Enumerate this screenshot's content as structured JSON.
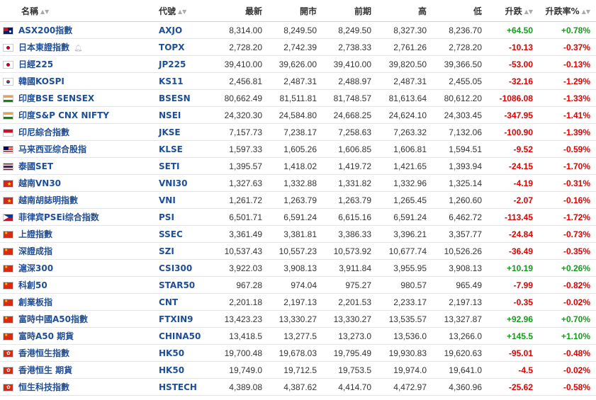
{
  "headers": {
    "name": "名稱",
    "code": "代號",
    "last": "最新",
    "open": "開市",
    "prev": "前期",
    "high": "高",
    "low": "低",
    "change": "升跌",
    "change_pct": "升跌率%"
  },
  "colors": {
    "positive": "#149b1c",
    "negative": "#e00000",
    "link": "#1f4e96"
  },
  "rows": [
    {
      "flag": "au",
      "name": "ASX200指數",
      "code": "AXJO",
      "last": "8,314.00",
      "open": "8,249.50",
      "prev": "8,249.50",
      "high": "8,327.30",
      "low": "8,236.70",
      "change": "+64.50",
      "pct": "+0.78%",
      "dir": "pos"
    },
    {
      "flag": "jp",
      "name": "日本東證指數",
      "code": "TOPX",
      "last": "2,728.20",
      "open": "2,742.39",
      "prev": "2,738.33",
      "high": "2,761.26",
      "low": "2,728.20",
      "change": "-10.13",
      "pct": "-0.37%",
      "dir": "neg",
      "bell": true
    },
    {
      "flag": "jp",
      "name": "日經225",
      "code": "JP225",
      "last": "39,410.00",
      "open": "39,626.00",
      "prev": "39,410.00",
      "high": "39,820.50",
      "low": "39,366.50",
      "change": "-53.00",
      "pct": "-0.13%",
      "dir": "neg"
    },
    {
      "flag": "kr",
      "name": "韓國KOSPI",
      "code": "KS11",
      "last": "2,456.81",
      "open": "2,487.31",
      "prev": "2,488.97",
      "high": "2,487.31",
      "low": "2,455.05",
      "change": "-32.16",
      "pct": "-1.29%",
      "dir": "neg"
    },
    {
      "flag": "in",
      "name": "印度BSE SENSEX",
      "code": "BSESN",
      "last": "80,662.49",
      "open": "81,511.81",
      "prev": "81,748.57",
      "high": "81,613.64",
      "low": "80,612.20",
      "change": "-1086.08",
      "pct": "-1.33%",
      "dir": "neg"
    },
    {
      "flag": "in",
      "name": "印度S&P CNX NIFTY",
      "code": "NSEI",
      "last": "24,320.30",
      "open": "24,584.80",
      "prev": "24,668.25",
      "high": "24,624.10",
      "low": "24,303.45",
      "change": "-347.95",
      "pct": "-1.41%",
      "dir": "neg"
    },
    {
      "flag": "id",
      "name": "印尼綜合指數",
      "code": "JKSE",
      "last": "7,157.73",
      "open": "7,238.17",
      "prev": "7,258.63",
      "high": "7,263.32",
      "low": "7,132.06",
      "change": "-100.90",
      "pct": "-1.39%",
      "dir": "neg"
    },
    {
      "flag": "my",
      "name": "马来西亚综合股指",
      "code": "KLSE",
      "last": "1,597.33",
      "open": "1,605.26",
      "prev": "1,606.85",
      "high": "1,606.81",
      "low": "1,594.51",
      "change": "-9.52",
      "pct": "-0.59%",
      "dir": "neg"
    },
    {
      "flag": "th",
      "name": "泰國SET",
      "code": "SETI",
      "last": "1,395.57",
      "open": "1,418.02",
      "prev": "1,419.72",
      "high": "1,421.65",
      "low": "1,393.94",
      "change": "-24.15",
      "pct": "-1.70%",
      "dir": "neg"
    },
    {
      "flag": "vn",
      "name": "越南VN30",
      "code": "VNI30",
      "last": "1,327.63",
      "open": "1,332.88",
      "prev": "1,331.82",
      "high": "1,332.96",
      "low": "1,325.14",
      "change": "-4.19",
      "pct": "-0.31%",
      "dir": "neg"
    },
    {
      "flag": "vn",
      "name": "越南胡誌明指數",
      "code": "VNI",
      "last": "1,261.72",
      "open": "1,263.79",
      "prev": "1,263.79",
      "high": "1,265.45",
      "low": "1,260.60",
      "change": "-2.07",
      "pct": "-0.16%",
      "dir": "neg"
    },
    {
      "flag": "ph",
      "name": "菲律宾PSEi综合指数",
      "code": "PSI",
      "last": "6,501.71",
      "open": "6,591.24",
      "prev": "6,615.16",
      "high": "6,591.24",
      "low": "6,462.72",
      "change": "-113.45",
      "pct": "-1.72%",
      "dir": "neg"
    },
    {
      "flag": "cn",
      "name": "上證指數",
      "code": "SSEC",
      "last": "3,361.49",
      "open": "3,381.81",
      "prev": "3,386.33",
      "high": "3,396.21",
      "low": "3,357.77",
      "change": "-24.84",
      "pct": "-0.73%",
      "dir": "neg"
    },
    {
      "flag": "cn",
      "name": "深證成指",
      "code": "SZI",
      "last": "10,537.43",
      "open": "10,557.23",
      "prev": "10,573.92",
      "high": "10,677.74",
      "low": "10,526.26",
      "change": "-36.49",
      "pct": "-0.35%",
      "dir": "neg"
    },
    {
      "flag": "cn",
      "name": "滬深300",
      "code": "CSI300",
      "last": "3,922.03",
      "open": "3,908.13",
      "prev": "3,911.84",
      "high": "3,955.95",
      "low": "3,908.13",
      "change": "+10.19",
      "pct": "+0.26%",
      "dir": "pos"
    },
    {
      "flag": "cn",
      "name": "科創50",
      "code": "STAR50",
      "last": "967.28",
      "open": "974.04",
      "prev": "975.27",
      "high": "980.57",
      "low": "965.49",
      "change": "-7.99",
      "pct": "-0.82%",
      "dir": "neg"
    },
    {
      "flag": "cn",
      "name": "創業板指",
      "code": "CNT",
      "last": "2,201.18",
      "open": "2,197.13",
      "prev": "2,201.53",
      "high": "2,233.17",
      "low": "2,197.13",
      "change": "-0.35",
      "pct": "-0.02%",
      "dir": "neg"
    },
    {
      "flag": "cn",
      "name": "富時中國A50指數",
      "code": "FTXIN9",
      "last": "13,423.23",
      "open": "13,330.27",
      "prev": "13,330.27",
      "high": "13,535.57",
      "low": "13,327.87",
      "change": "+92.96",
      "pct": "+0.70%",
      "dir": "pos"
    },
    {
      "flag": "cn",
      "name": "富時A50 期貨",
      "code": "CHINA50",
      "last": "13,418.5",
      "open": "13,277.5",
      "prev": "13,273.0",
      "high": "13,536.0",
      "low": "13,266.0",
      "change": "+145.5",
      "pct": "+1.10%",
      "dir": "pos"
    },
    {
      "flag": "hk",
      "name": "香港恒生指數",
      "code": "HK50",
      "last": "19,700.48",
      "open": "19,678.03",
      "prev": "19,795.49",
      "high": "19,930.83",
      "low": "19,620.63",
      "change": "-95.01",
      "pct": "-0.48%",
      "dir": "neg"
    },
    {
      "flag": "hk",
      "name": "香港恒生 期貨",
      "code": "HK50",
      "last": "19,749.0",
      "open": "19,712.5",
      "prev": "19,753.5",
      "high": "19,974.0",
      "low": "19,641.0",
      "change": "-4.5",
      "pct": "-0.02%",
      "dir": "neg"
    },
    {
      "flag": "hk",
      "name": "恒生科技指數",
      "code": "HSTECH",
      "last": "4,389.08",
      "open": "4,387.62",
      "prev": "4,414.70",
      "high": "4,472.97",
      "low": "4,360.96",
      "change": "-25.62",
      "pct": "-0.58%",
      "dir": "neg"
    }
  ]
}
